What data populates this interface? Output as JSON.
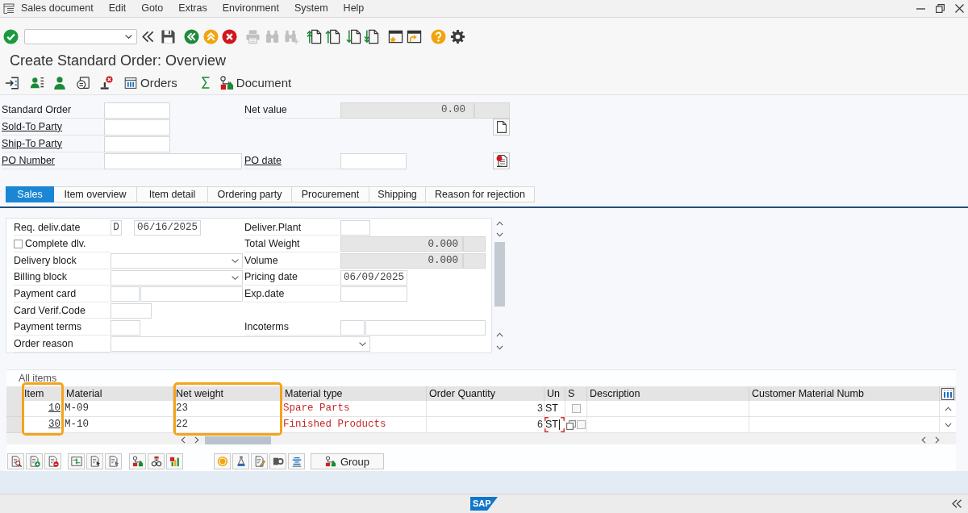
{
  "menu_bar": {
    "items": [
      "Sales document",
      "Edit",
      "Goto",
      "Extras",
      "Environment",
      "System",
      "Help"
    ]
  },
  "toolbar": {
    "buttons": [
      {
        "disabled": false
      },
      {
        "disabled": false
      },
      {
        "disabled": false
      },
      {
        "disabled": false
      },
      {
        "disabled": false
      },
      {
        "disabled": false
      },
      {
        "disabled": true
      },
      {
        "disabled": true
      },
      {
        "disabled": true
      },
      {
        "disabled": false
      },
      {
        "disabled": false
      },
      {
        "disabled": false
      },
      {
        "disabled": false
      },
      {
        "disabled": false
      },
      {
        "disabled": false
      },
      {
        "disabled": false
      },
      {
        "disabled": false
      }
    ]
  },
  "title": "Create Standard Order: Overview",
  "app_toolbar": {
    "orders_button": "Orders",
    "document_button": "Document"
  },
  "header": {
    "rows": [
      {
        "left": {
          "label": "Standard Order",
          "link": false,
          "read_only": false
        },
        "right": {
          "label": "Net value",
          "link": false,
          "read_only": true,
          "value": "0.00"
        }
      },
      {
        "left": {
          "label": "Sold-To Party",
          "link": true,
          "read_only": false
        }
      },
      {
        "left": {
          "label": "Ship-To Party",
          "link": true,
          "read_only": false
        }
      },
      {
        "left": {
          "label": "PO Number",
          "link": true,
          "read_only": false
        },
        "right": {
          "label": "PO date",
          "link": true,
          "read_only": false
        }
      }
    ]
  },
  "tabs": [
    {
      "label": "Sales",
      "selected": true
    },
    {
      "label": "Item overview",
      "selected": false
    },
    {
      "label": "Item detail",
      "selected": false
    },
    {
      "label": "Ordering party",
      "selected": false
    },
    {
      "label": "Procurement",
      "selected": false
    },
    {
      "label": "Shipping",
      "selected": false
    },
    {
      "label": "Reason for rejection",
      "selected": false
    }
  ],
  "sales_tab": {
    "rows": [
      {
        "left": {
          "label": "Req. deliv.date",
          "kind": "date",
          "type_value": "D",
          "value": "06/16/2025"
        },
        "right": {
          "label": "Deliver.Plant",
          "kind": "input"
        }
      },
      {
        "left": {
          "label": "Complete dlv.",
          "kind": "checkbox",
          "checked": false
        },
        "right": {
          "label": "Total Weight",
          "kind": "readonly",
          "value": "0.000"
        }
      },
      {
        "left": {
          "label": "Delivery block",
          "kind": "dropdown"
        },
        "right": {
          "label": "Volume",
          "kind": "readonly",
          "value": "0.000"
        }
      },
      {
        "left": {
          "label": "Billing block",
          "kind": "dropdown"
        },
        "right": {
          "label": "Pricing date",
          "kind": "input",
          "value": "06/09/2025"
        }
      },
      {
        "left": {
          "label": "Payment card",
          "kind": "pair"
        },
        "right": {
          "label": "Exp.date",
          "kind": "input"
        }
      },
      {
        "left": {
          "label": "Card Verif.Code",
          "kind": "input"
        }
      },
      {
        "left": {
          "label": "Payment terms",
          "kind": "input"
        },
        "right": {
          "label": "Incoterms",
          "kind": "pair"
        }
      },
      {
        "left": {
          "label": "Order reason",
          "kind": "dropdown"
        }
      }
    ]
  },
  "items_table": {
    "title": "All items",
    "columns": [
      {
        "label": "Item",
        "highlighted": true
      },
      {
        "label": "Material",
        "highlighted": false
      },
      {
        "label": "Net weight",
        "highlighted": true
      },
      {
        "label": "Material type",
        "highlighted": false
      },
      {
        "label": "Order Quantity",
        "highlighted": false
      },
      {
        "label": "Un",
        "highlighted": false
      },
      {
        "label": "S",
        "highlighted": false
      },
      {
        "label": "Description",
        "highlighted": false
      },
      {
        "label": "Customer Material Numb",
        "highlighted": false
      }
    ],
    "rows": [
      {
        "cells": [
          "10",
          "M-09",
          "23",
          "Spare Parts",
          "3",
          "ST"
        ],
        "checked": false,
        "unit_focused": false
      },
      {
        "cells": [
          "30",
          "M-10",
          "22",
          "Finished Products",
          "6",
          "ST"
        ],
        "checked": false,
        "unit_focused": true
      }
    ]
  },
  "bottom_toolbar": {
    "group_button": "Group"
  },
  "status_bar": {
    "logo": "SAP"
  }
}
